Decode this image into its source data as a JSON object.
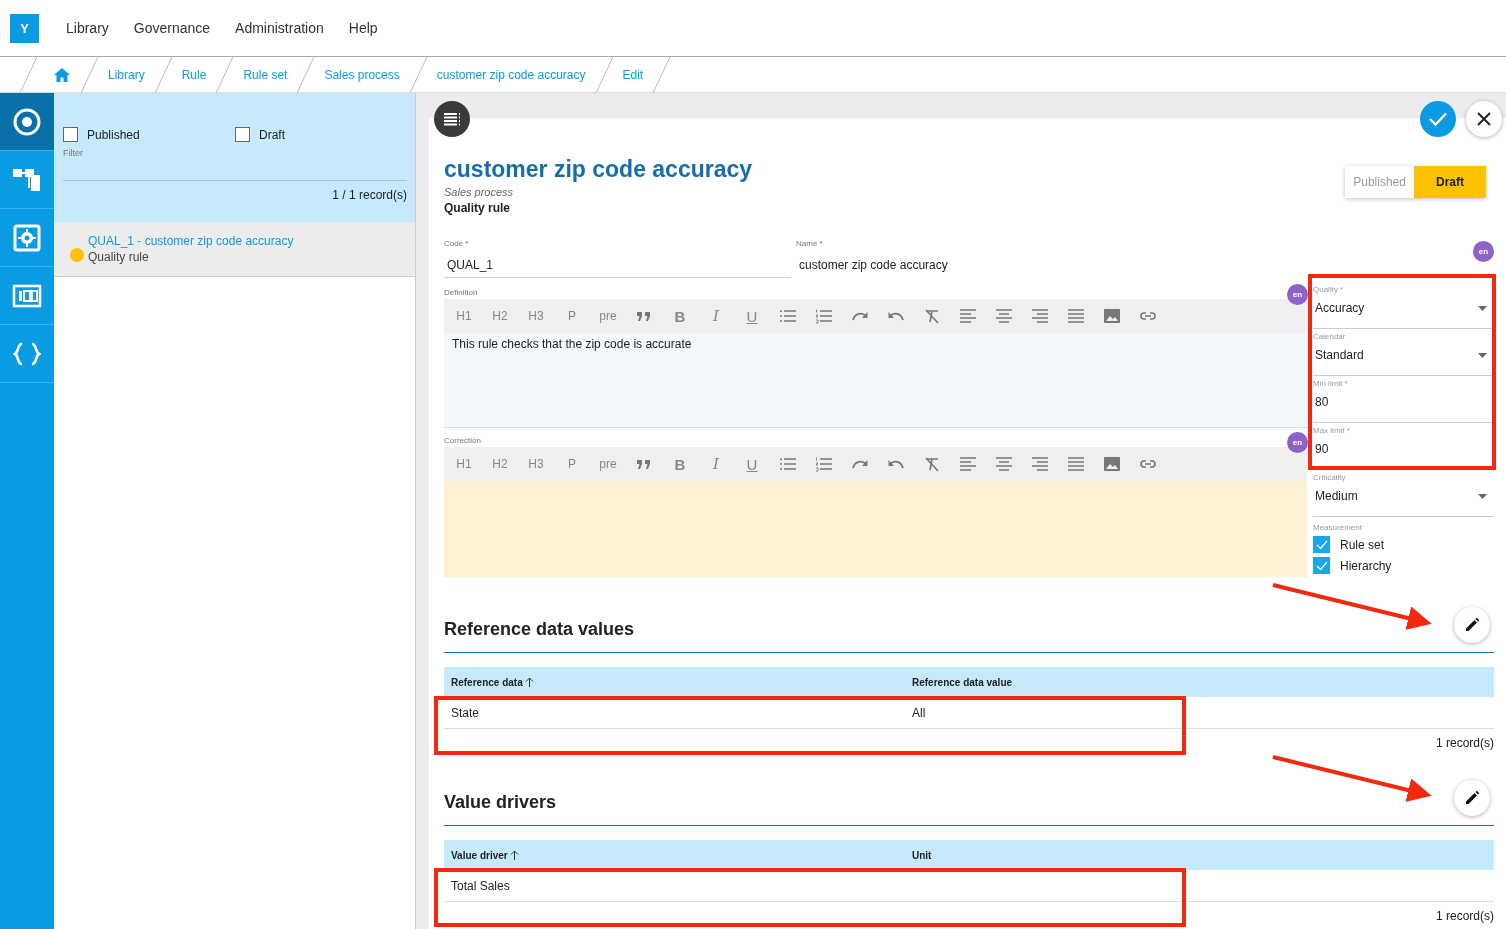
{
  "logo": "Y",
  "menu": [
    {
      "label": "Library"
    },
    {
      "label": "Governance"
    },
    {
      "label": "Administration"
    },
    {
      "label": "Help"
    }
  ],
  "breadcrumb": [
    {
      "label": "Library"
    },
    {
      "label": "Rule"
    },
    {
      "label": "Rule set"
    },
    {
      "label": "Sales process"
    },
    {
      "label": "customer zip code accuracy"
    },
    {
      "label": "Edit"
    }
  ],
  "rail": [
    {
      "kind": "target",
      "selected": true
    },
    {
      "kind": "hierarchy",
      "selected": false
    },
    {
      "kind": "gear",
      "selected": false
    },
    {
      "kind": "meter",
      "selected": false
    },
    {
      "kind": "braces",
      "selected": false
    }
  ],
  "filter": {
    "options": [
      {
        "label": "Published",
        "checked": false
      },
      {
        "label": "Draft",
        "checked": false
      }
    ],
    "label": "Filter",
    "count": "1 / 1 record(s)"
  },
  "results": [
    {
      "title": "QUAL_1 - customer zip code accuracy",
      "subtitle": "Quality rule",
      "color": "#ffc107",
      "selected": true
    }
  ],
  "record": {
    "title": "customer zip code accuracy",
    "subtitle": "Sales process",
    "type": "Quality rule",
    "status": [
      {
        "label": "Published",
        "selected": false
      },
      {
        "label": "Draft",
        "selected": true
      }
    ],
    "fields": [
      {
        "label": "Code *",
        "value": "QUAL_1"
      },
      {
        "label": "Name *",
        "value": "customer zip code accuracy"
      }
    ],
    "language": "en",
    "editors": [
      {
        "kind": "definition",
        "label": "Definition",
        "language": "en",
        "text": "This rule checks that the zip code is accurate",
        "toolbar": [
          {
            "kind": "text",
            "label": "H1"
          },
          {
            "kind": "text",
            "label": "H2"
          },
          {
            "kind": "text",
            "label": "H3"
          },
          {
            "kind": "text",
            "label": "P"
          },
          {
            "kind": "text",
            "label": "pre"
          },
          {
            "kind": "quote"
          },
          {
            "kind": "bold",
            "label": "B"
          },
          {
            "kind": "italic",
            "label": "I"
          },
          {
            "kind": "underline",
            "label": "U"
          },
          {
            "kind": "bullets"
          },
          {
            "kind": "numbers"
          },
          {
            "kind": "redo"
          },
          {
            "kind": "undo"
          },
          {
            "kind": "clear"
          },
          {
            "kind": "align-left"
          },
          {
            "kind": "align-center"
          },
          {
            "kind": "align-right"
          },
          {
            "kind": "justify"
          },
          {
            "kind": "image"
          },
          {
            "kind": "link"
          }
        ]
      },
      {
        "kind": "correction",
        "label": "Correction",
        "language": "en",
        "toolbar": [
          {
            "kind": "text",
            "label": "H1"
          },
          {
            "kind": "text",
            "label": "H2"
          },
          {
            "kind": "text",
            "label": "H3"
          },
          {
            "kind": "text",
            "label": "P"
          },
          {
            "kind": "text",
            "label": "pre"
          },
          {
            "kind": "quote"
          },
          {
            "kind": "bold",
            "label": "B"
          },
          {
            "kind": "italic",
            "label": "I"
          },
          {
            "kind": "underline",
            "label": "U"
          },
          {
            "kind": "bullets"
          },
          {
            "kind": "numbers"
          },
          {
            "kind": "redo"
          },
          {
            "kind": "undo"
          },
          {
            "kind": "clear"
          },
          {
            "kind": "align-left"
          },
          {
            "kind": "align-center"
          },
          {
            "kind": "align-right"
          },
          {
            "kind": "justify"
          },
          {
            "kind": "image"
          },
          {
            "kind": "link"
          }
        ]
      }
    ],
    "properties": [
      {
        "kind": "select",
        "label": "Quality *",
        "value": "Accuracy"
      },
      {
        "kind": "select",
        "label": "Calendar",
        "value": "Standard"
      },
      {
        "kind": "input",
        "label": "Min limit *",
        "value": "80"
      },
      {
        "kind": "input",
        "label": "Max limit *",
        "value": "90"
      },
      {
        "kind": "select",
        "label": "Criticality",
        "value": "Medium"
      }
    ],
    "measurement": {
      "label": "Measurement",
      "options": [
        {
          "label": "Rule set",
          "checked": true
        },
        {
          "label": "Hierarchy",
          "checked": true
        }
      ]
    },
    "sections": [
      {
        "title": "Reference data values",
        "columns": [
          {
            "label": "Reference data",
            "sorted": true
          },
          {
            "label": "Reference data value",
            "sorted": false
          }
        ],
        "rows": [
          [
            "State",
            "All"
          ]
        ],
        "count": "1 record(s)"
      },
      {
        "title": "Value drivers",
        "columns": [
          {
            "label": "Value driver",
            "sorted": true
          },
          {
            "label": "Unit",
            "sorted": false
          }
        ],
        "rows": [
          [
            "Total Sales",
            ""
          ]
        ],
        "count": "1 record(s)"
      }
    ]
  }
}
